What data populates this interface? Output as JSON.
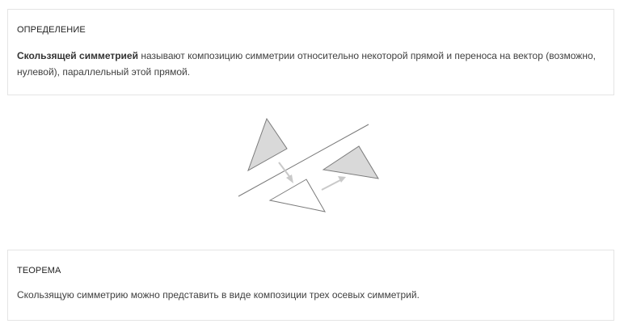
{
  "definition": {
    "title": "ОПРЕДЕЛЕНИЕ",
    "term": "Скользящей симметрией",
    "text": " называют композицию симметрии относительно некоторой прямой и переноса на вектор (возможно, нулевой), параллельный этой прямой."
  },
  "figure": {
    "shaded_color": "#d9d9d9",
    "stroke_color": "#7a7a7a",
    "arrow_color": "#c9c9c9"
  },
  "theorem": {
    "title": "ТЕОРЕМА",
    "text": "Скользящую симметрию можно представить в виде композиции трех осевых симметрий."
  }
}
